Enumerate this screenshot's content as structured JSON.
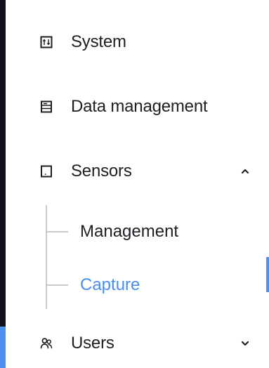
{
  "navigation": {
    "items": [
      {
        "label": "System",
        "icon": "system-icon"
      },
      {
        "label": "Data management",
        "icon": "data-management-icon"
      },
      {
        "label": "Sensors",
        "icon": "sensor-icon",
        "expanded": true,
        "children": [
          {
            "label": "Management",
            "active": false
          },
          {
            "label": "Capture",
            "active": true
          }
        ]
      },
      {
        "label": "Users",
        "icon": "users-icon",
        "expanded": false
      }
    ]
  },
  "colors": {
    "active": "#4a8df0",
    "text": "#1e1f24",
    "tree": "#c8c9cf",
    "border": "#11131a"
  }
}
